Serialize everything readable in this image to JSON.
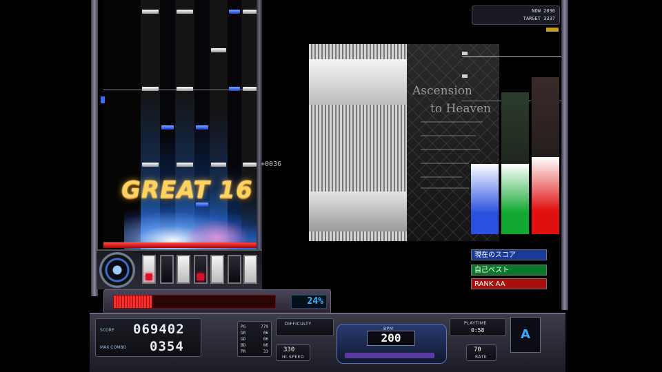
{
  "judgement": {
    "label": "GREAT",
    "combo": "16",
    "timing": "+0036"
  },
  "gauge": {
    "percent": "24%",
    "fill_fraction": 0.24
  },
  "score_panel": {
    "score_label": "SCORE",
    "score_value": "069402",
    "combo_label": "MAX COMBO",
    "combo_value": "0354"
  },
  "judge_counts": [
    {
      "label": "PG",
      "value": "7",
      "count": "79"
    },
    {
      "label": "GR",
      "value": "",
      "count": "06"
    },
    {
      "label": "GD",
      "value": "",
      "count": "06"
    },
    {
      "label": "BD",
      "value": "",
      "count": "06"
    },
    {
      "label": "PR",
      "value": "",
      "count": "33"
    }
  ],
  "difficulty": {
    "label": "DIFFICULTY"
  },
  "hispeed": {
    "value": "330",
    "label": "HI-SPEED"
  },
  "bpm": {
    "label": "BPM",
    "value": "200"
  },
  "playtime": {
    "label": "PLAYTIME",
    "value": "0:58"
  },
  "rate": {
    "value": "70",
    "label": "RATE"
  },
  "rank_letter": "A",
  "graph": {
    "current_label": "NOW",
    "current_value": "2036",
    "target_label": "TARGET",
    "target_value": "3337",
    "legend": [
      {
        "label": "現在のスコア",
        "color": "#1a3a9a"
      },
      {
        "label": "自己ベスト",
        "color": "#0a7a2a"
      },
      {
        "label": "RANK AA",
        "color": "#a81010"
      }
    ],
    "bars": [
      {
        "name": "current",
        "fraction": 0.47,
        "color_top": "#ffffff",
        "color_bot": "#2a50e0"
      },
      {
        "name": "best",
        "fraction": 0.47,
        "color_top": "#ffffff",
        "color_bot": "#10a830",
        "ghost": "#2c3c2c"
      },
      {
        "name": "rank",
        "fraction": 0.52,
        "color_top": "#ffffff",
        "color_bot": "#e01010",
        "ghost": "#3a2a2a"
      }
    ]
  },
  "bga": {
    "title_line1": "Ascension",
    "title_line2": "to Heaven"
  }
}
